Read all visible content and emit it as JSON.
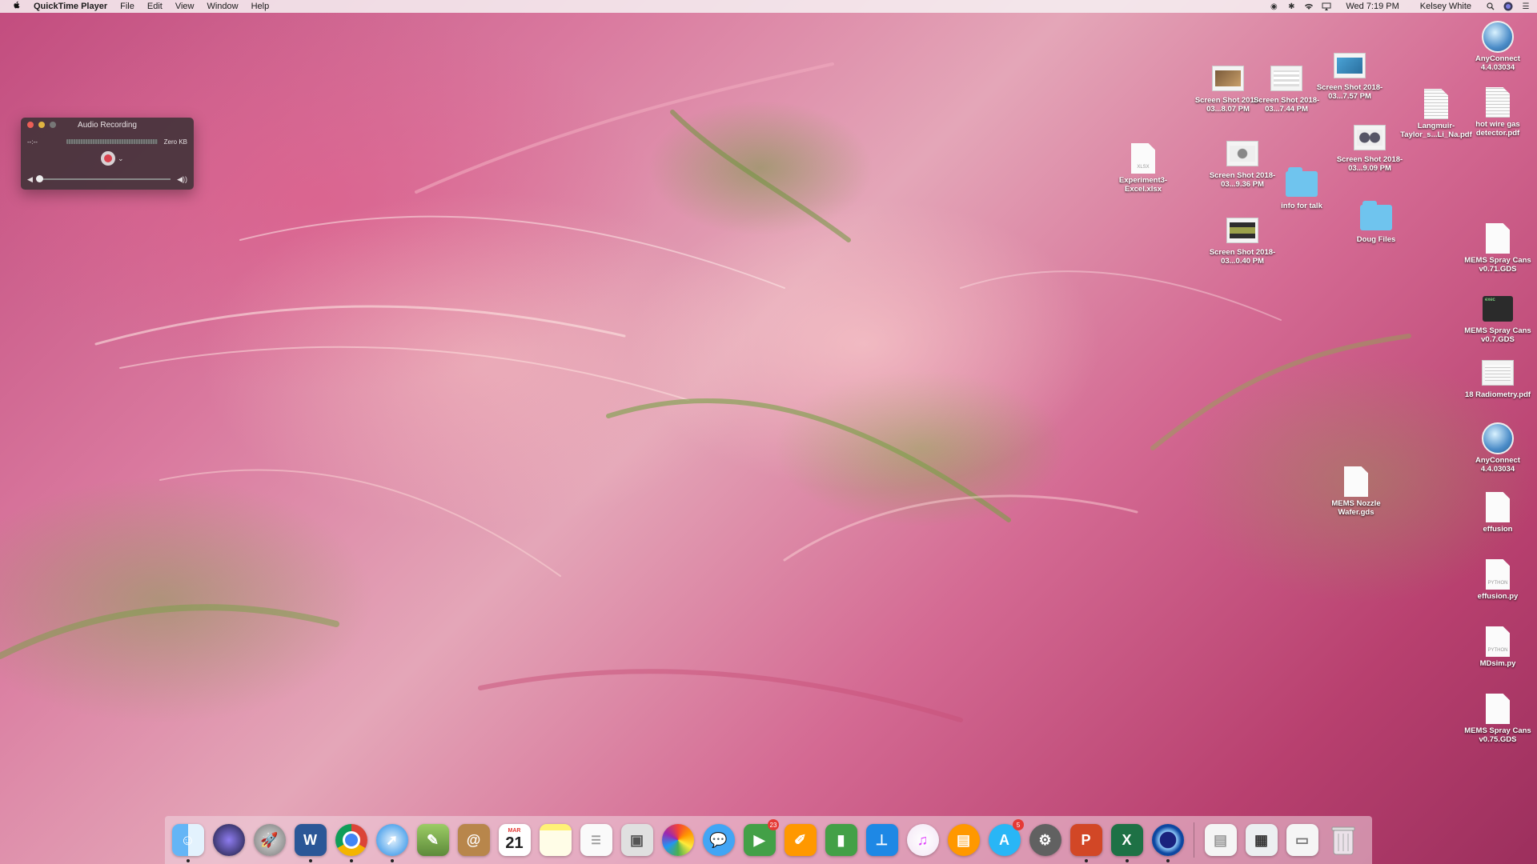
{
  "menubar": {
    "apple": "",
    "app": "QuickTime Player",
    "menus": [
      "File",
      "Edit",
      "View",
      "Window",
      "Help"
    ],
    "clock": "Wed 7:19 PM",
    "user": "Kelsey White"
  },
  "quicktime": {
    "title": "Audio Recording",
    "time": "--:--",
    "size": "Zero KB",
    "volume": 0.0
  },
  "desktop": {
    "anyconnect1": "AnyConnect 4.4.03034",
    "shot_807": "Screen Shot 2018-03...8.07 PM",
    "shot_744": "Screen Shot 2018-03...7.44 PM",
    "shot_757": "Screen Shot 2018-03...7.57 PM",
    "langmuir": "Langmuir-Taylor_s...Li_Na.pdf",
    "hotwire": "hot wire gas detector.pdf",
    "excel": "Experiment3-Excel.xlsx",
    "excel_tag": "XLSX",
    "shot_936": "Screen Shot 2018-03...9.36 PM",
    "info": "info for talk",
    "shot_909": "Screen Shot 2018-03...9.09 PM",
    "doug": "Doug Files",
    "shot_040": "Screen Shot 2018-03...0.40 PM",
    "mems71": "MEMS Spray Cans v0.71.GDS",
    "mems7": "MEMS Spray Cans v0.7.GDS",
    "exec_tag": "exec",
    "radiometry": "18 Radiometry.pdf",
    "anyconnect2": "AnyConnect 4.4.03034",
    "nozzle": "MEMS Nozzle Wafer.gds",
    "effusion": "effusion",
    "effusion_py": "effusion.py",
    "py_tag": "PYTHON",
    "mdsim": "MDsim.py",
    "mems75": "MEMS Spray Cans v0.75.GDS"
  },
  "dock": {
    "calendar_month": "MAR",
    "calendar_day": "21",
    "facetime_badge": "23",
    "appstore_badge": "5",
    "word_letter": "W",
    "excel_letter": "X",
    "ppt_letter": "P"
  }
}
